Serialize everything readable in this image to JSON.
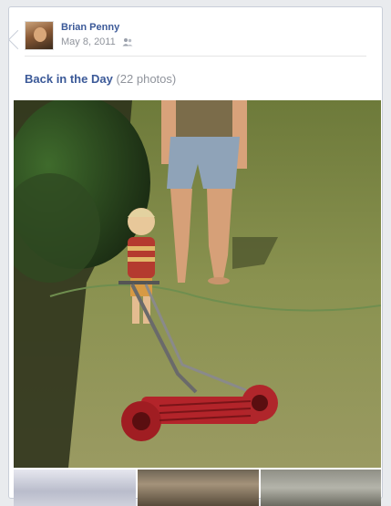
{
  "post": {
    "author": "Brian Penny",
    "date": "May 8, 2011",
    "privacy_icon": "friends-icon",
    "album_title": "Back in the Day",
    "photo_count": "(22 photos)"
  },
  "colors": {
    "link": "#3b5998",
    "meta": "#90949c"
  }
}
